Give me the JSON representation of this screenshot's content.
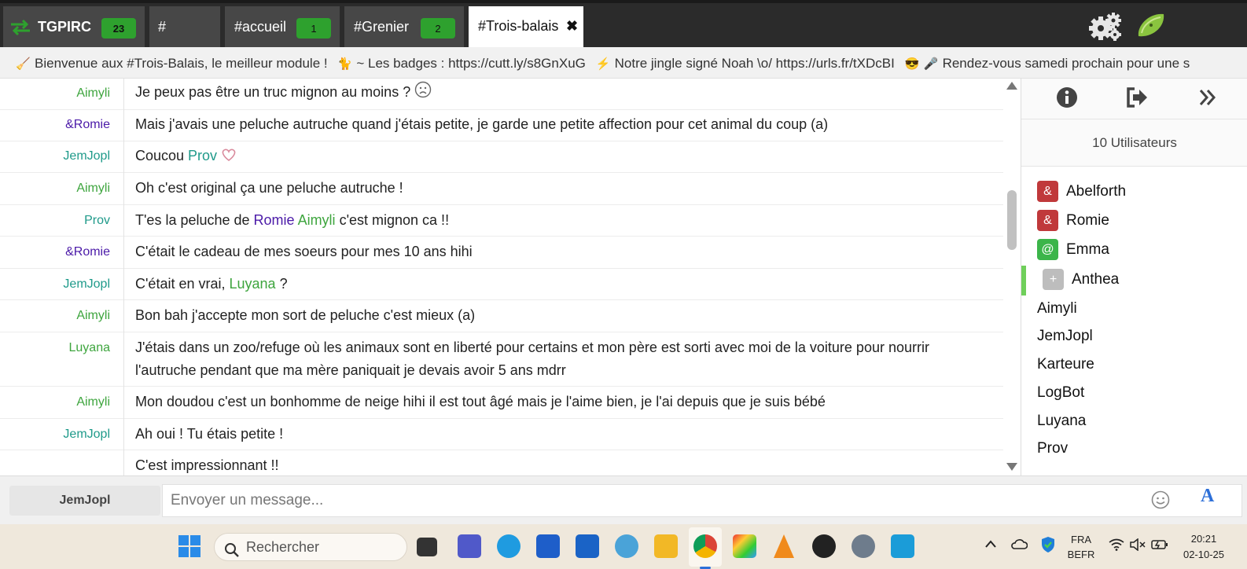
{
  "app": {
    "name": "TGPIRC",
    "unread": "23"
  },
  "tabs": [
    {
      "label": "#",
      "badge": ""
    },
    {
      "label": "#accueil",
      "badge": "1"
    },
    {
      "label": "#Grenier",
      "badge": "2"
    },
    {
      "label": "#Trois-balais",
      "badge": "",
      "close": "✖"
    }
  ],
  "topic": {
    "segments": [
      "Bienvenue aux #Trois-Balais, le meilleur module !",
      "~ Les badges : https://cutt.ly/s8GnXuG",
      "Notre jingle signé Noah \\o/ https://urls.fr/tXDcBI",
      "Rendez-vous samedi prochain pour une s"
    ]
  },
  "messages": [
    {
      "nick": "Aimyli",
      "text": "Je peux pas être un truc mignon au moins ?"
    },
    {
      "nick": "&Romie",
      "text": "Mais j'avais une peluche autruche quand j'étais petite, je garde une petite affection pour cet animal du coup (a)"
    },
    {
      "nick": "JemJopl",
      "text_before": "Coucou ",
      "mention": "Prov"
    },
    {
      "nick": "Aimyli",
      "text": "Oh c'est original ça une peluche autruche !"
    },
    {
      "nick": "Prov",
      "text_before": "T'es la peluche de ",
      "mention1": "Romie",
      "mention2": "Aimyli",
      "text_after": " c'est mignon ca !!"
    },
    {
      "nick": "&Romie",
      "text": "C'était le cadeau de mes soeurs pour mes 10 ans hihi"
    },
    {
      "nick": "JemJopl",
      "text_before": "C'était en vrai, ",
      "mention": "Luyana",
      "text_after": " ?"
    },
    {
      "nick": "Aimyli",
      "text": "Bon bah j'accepte mon sort de peluche c'est mieux (a)"
    },
    {
      "nick": "Luyana",
      "text": "J'étais dans un zoo/refuge où les animaux sont en liberté pour certains et mon père est sorti avec moi de la voiture pour nourrir l'autruche pendant que ma mère paniquait je devais avoir 5 ans mdrr"
    },
    {
      "nick": "Aimyli",
      "text": "Mon doudou c'est un bonhomme de neige hihi il est tout âgé mais je l'aime bien, je l'ai depuis que je suis bébé"
    },
    {
      "nick": "JemJopl",
      "text": "Ah oui ! Tu étais petite !"
    },
    {
      "nick": "",
      "text": "C'est impressionnant !!"
    }
  ],
  "sidebar": {
    "user_count": "10 Utilisateurs",
    "users": [
      {
        "mode": "&",
        "name": "Abelforth"
      },
      {
        "mode": "&",
        "name": "Romie"
      },
      {
        "mode": "@",
        "name": "Emma"
      },
      {
        "mode": "+",
        "name": "Anthea"
      },
      {
        "mode": "",
        "name": "Aimyli"
      },
      {
        "mode": "",
        "name": "JemJopl"
      },
      {
        "mode": "",
        "name": "Karteure"
      },
      {
        "mode": "",
        "name": "LogBot"
      },
      {
        "mode": "",
        "name": "Luyana"
      },
      {
        "mode": "",
        "name": "Prov"
      }
    ]
  },
  "input": {
    "nick": "JemJopl",
    "placeholder": "Envoyer un message...",
    "format_label": "A"
  },
  "taskbar": {
    "search_placeholder": "Rechercher",
    "lang_top": "FRA",
    "lang_bottom": "BEFR",
    "time": "20:21",
    "date": "02-10-25"
  },
  "colors": {
    "accent_green": "#2ea12e",
    "topbar": "#2b2b2b",
    "nick_green": "#3ea53e",
    "nick_teal": "#1f9a8a",
    "nick_purple": "#4b1aa8",
    "op_red": "#c0393b"
  }
}
